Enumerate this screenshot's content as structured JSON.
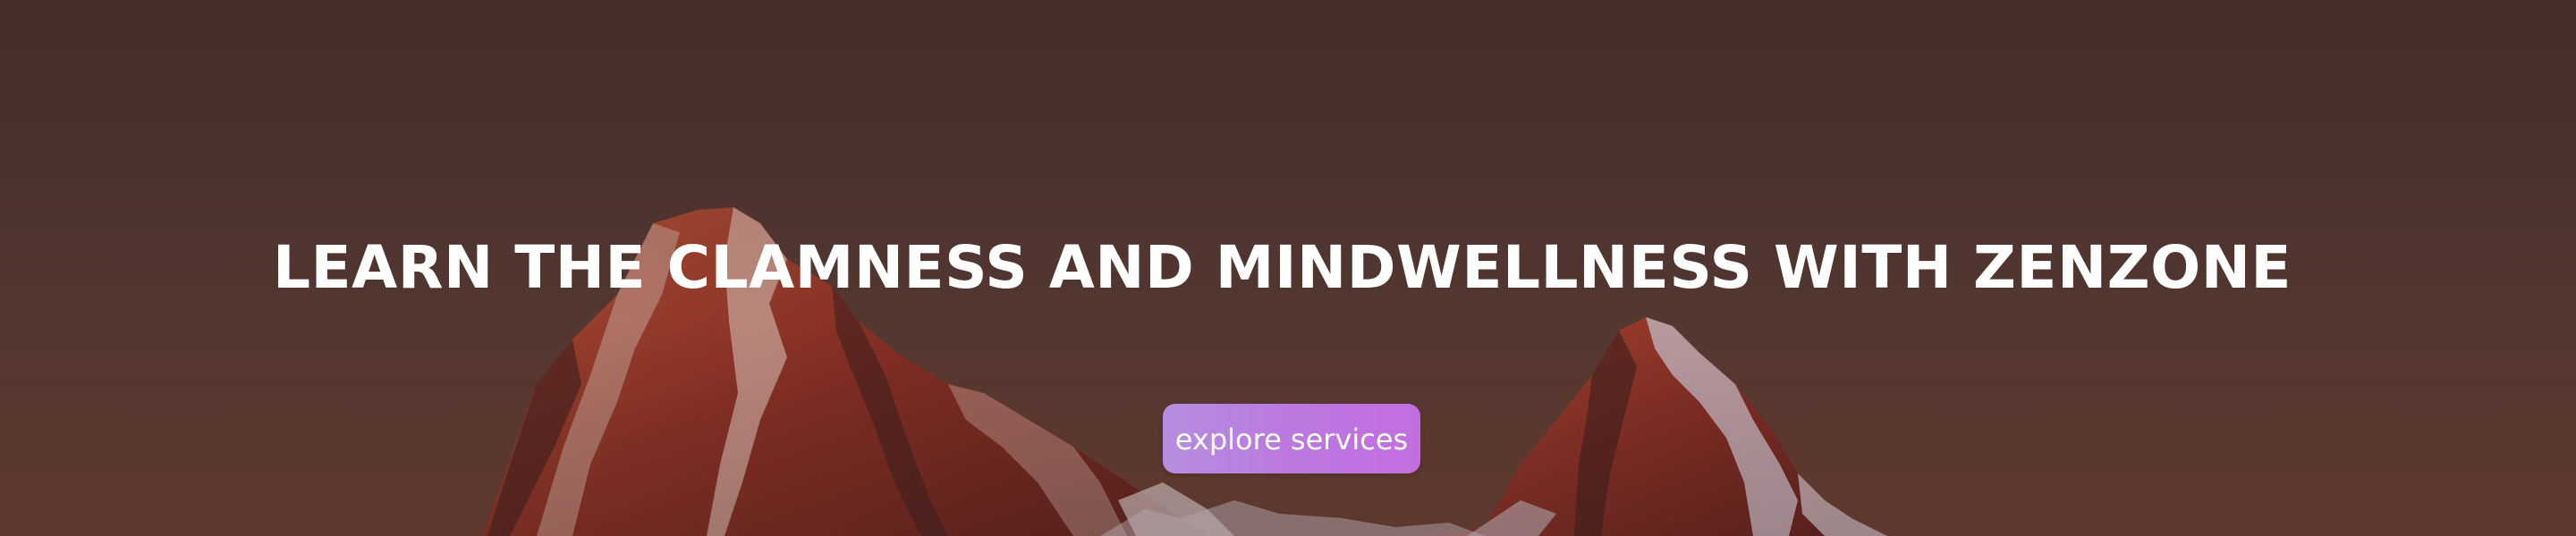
{
  "hero": {
    "headline": "LEARN THE CLAMNESS AND MINDWELLNESS WITH ZENZONE",
    "cta_label": "explore services",
    "background_image": "mountain-peaks-sunset",
    "colors": {
      "text": "#ffffff",
      "cta_gradient_start": "#b58ee0",
      "cta_gradient_end": "#c36ee0",
      "overlay": "#4a2f2c"
    }
  }
}
